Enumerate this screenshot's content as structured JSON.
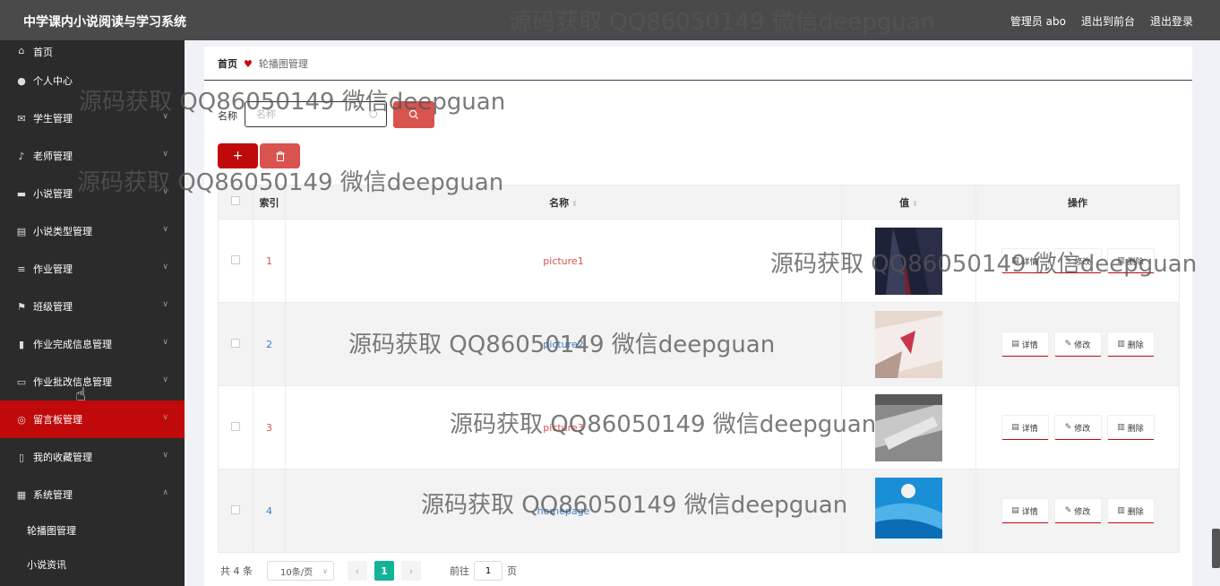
{
  "header": {
    "app_title": "中学课内小说阅读与学习系统",
    "user_label": "管理员 abo",
    "to_front": "退出到前台",
    "logout": "退出登录"
  },
  "sidebar": {
    "items": [
      {
        "label": "首页",
        "icon": "home-icon"
      },
      {
        "label": "个人中心",
        "icon": "user-icon"
      },
      {
        "label": "学生管理",
        "icon": "mail-icon"
      },
      {
        "label": "老师管理",
        "icon": "mic-icon"
      },
      {
        "label": "小说管理",
        "icon": "book-icon"
      },
      {
        "label": "小说类型管理",
        "icon": "clipboard-icon"
      },
      {
        "label": "作业管理",
        "icon": "list-icon"
      },
      {
        "label": "班级管理",
        "icon": "flag-icon"
      },
      {
        "label": "作业完成信息管理",
        "icon": "bar-chart-icon"
      },
      {
        "label": "作业批改信息管理",
        "icon": "monitor-icon"
      },
      {
        "label": "留言板管理",
        "icon": "compass-icon"
      },
      {
        "label": "我的收藏管理",
        "icon": "phone-icon"
      },
      {
        "label": "系统管理",
        "icon": "grid-icon"
      }
    ],
    "sub_items": [
      {
        "label": "轮播图管理"
      },
      {
        "label": "小说资讯"
      }
    ],
    "active_color": "#c0090b"
  },
  "breadcrumb": {
    "home": "首页",
    "current": "轮播图管理"
  },
  "search": {
    "label": "名称",
    "placeholder": "名称"
  },
  "table": {
    "headers": {
      "index": "索引",
      "name": "名称",
      "value": "值",
      "ops": "操作"
    },
    "rows": [
      {
        "index": "1",
        "name": "picture1"
      },
      {
        "index": "2",
        "name": "picture2"
      },
      {
        "index": "3",
        "name": "picture3"
      },
      {
        "index": "4",
        "name": "homepage"
      }
    ],
    "op_labels": {
      "detail": "详情",
      "edit": "修改",
      "delete": "删除"
    }
  },
  "pagination": {
    "total": "共 4 条",
    "page_size": "10条/页",
    "current_page": "1",
    "goto_label": "前往",
    "goto_value": "1",
    "page_unit": "页"
  },
  "watermark": "源码获取 QQ86050149 微信deepguan",
  "colors": {
    "header_bg": "#4a4a4a",
    "sidebar_bg": "#2b2b2b",
    "accent_red": "#c0090b",
    "button_red": "#d9534f",
    "pager_current": "#13b39a"
  }
}
